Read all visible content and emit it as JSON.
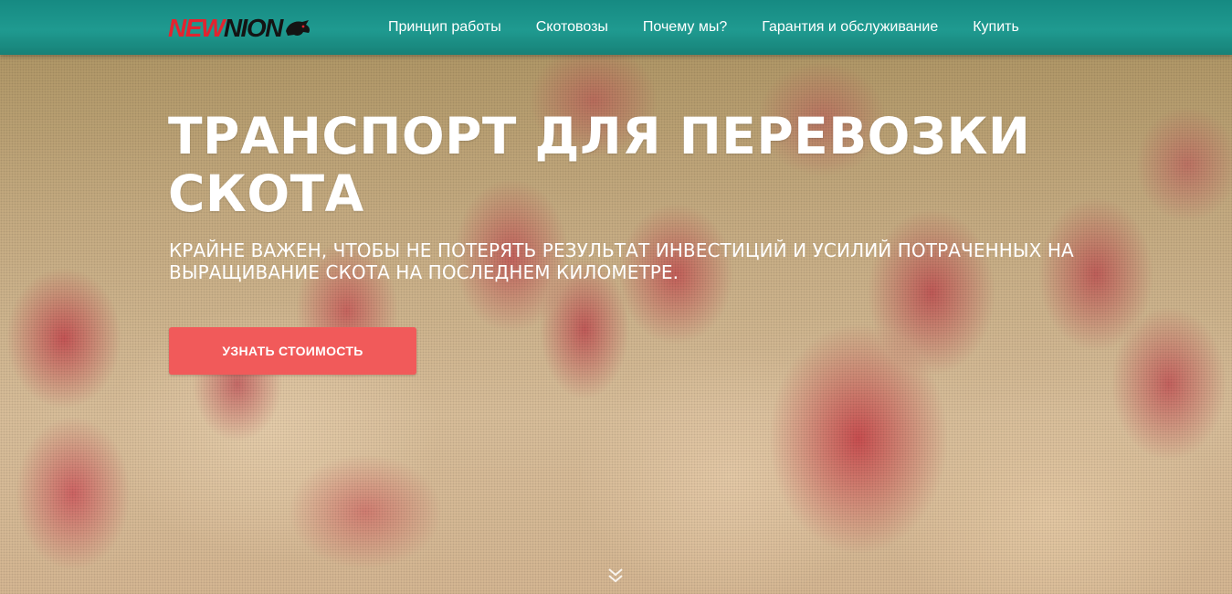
{
  "header": {
    "logo": {
      "part1": "NEW",
      "part2": "NION",
      "icon": "bull-head-icon"
    },
    "nav": [
      {
        "label": "Принцип работы"
      },
      {
        "label": "Скотовозы"
      },
      {
        "label": "Почему мы?"
      },
      {
        "label": "Гарантия и обслуживание"
      },
      {
        "label": "Купить"
      }
    ]
  },
  "hero": {
    "title": "ТРАНСПОРТ ДЛЯ ПЕРЕВОЗКИ СКОТА",
    "subtitle": "КРАЙНЕ ВАЖЕН, ЧТОБЫ НЕ ПОТЕРЯТЬ РЕЗУЛЬТАТ ИНВЕСТИЦИЙ И УСИЛИЙ ПОТРАЧЕННЫХ НА ВЫРАЩИВАНИЕ СКОТА НА ПОСЛЕДНЕМ КИЛОМЕТРЕ.",
    "cta_label": "УЗНАТЬ СТОИМОСТЬ",
    "scroll_icon": "double-chevron-down-icon"
  },
  "colors": {
    "header_bg": "#1f9a90",
    "logo_red": "#e3232f",
    "logo_dark": "#141414",
    "cta_bg": "#f15a5a",
    "text": "#ffffff"
  }
}
